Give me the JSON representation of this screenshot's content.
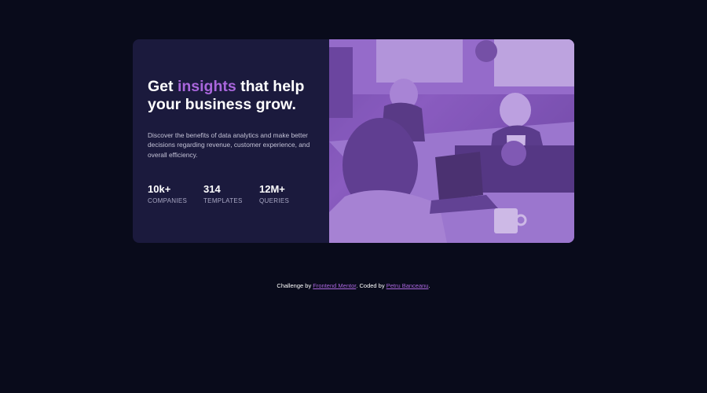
{
  "hero": {
    "title_before": "Get ",
    "title_accent": "insights",
    "title_after": " that help your business grow.",
    "description": "Discover the benefits of data analytics and make better decisions regarding revenue, customer experience, and overall efficiency.",
    "stats": [
      {
        "value": "10k+",
        "label": "COMPANIES"
      },
      {
        "value": "314",
        "label": "TEMPLATES"
      },
      {
        "value": "12M+",
        "label": "QUERIES"
      }
    ]
  },
  "footer": {
    "prefix": "Challenge by ",
    "link1": "Frontend Mentor",
    "middle": ". Coded by ",
    "link2": "Petru Banceanu",
    "suffix": "."
  },
  "colors": {
    "background": "#090b1b",
    "card": "#1b1a3d",
    "accent": "#a966dc",
    "photo_tint": "#8a5cc0"
  }
}
